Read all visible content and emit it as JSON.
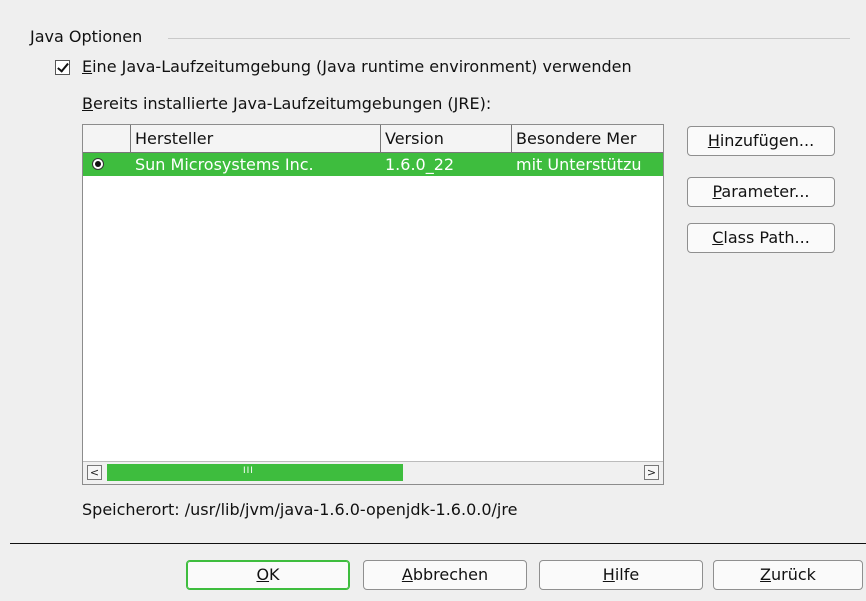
{
  "group": {
    "title": "Java Optionen",
    "checkbox_label_mnemonic": "E",
    "checkbox_label_rest": "ine Java-Laufzeitumgebung (Java runtime environment) verwenden",
    "checkbox_checked": true,
    "installed_label_mnemonic": "B",
    "installed_label_rest": "ereits installierte Java-Laufzeitumgebungen (JRE):"
  },
  "table": {
    "columns": [
      "",
      "Hersteller",
      "Version",
      "Besondere Mer"
    ],
    "rows": [
      {
        "selected": true,
        "vendor": "Sun Microsystems Inc.",
        "version": "1.6.0_22",
        "features": "mit Unterstützu"
      }
    ],
    "scroll_left": "<",
    "scroll_right": ">",
    "scroll_grip": "III"
  },
  "side_buttons": {
    "add": {
      "mnemonic": "H",
      "rest": "inzufügen..."
    },
    "params": {
      "mnemonic": "P",
      "rest": "arameter..."
    },
    "classpath": {
      "mnemonic": "C",
      "rest": "lass Path..."
    }
  },
  "location": "Speicherort: /usr/lib/jvm/java-1.6.0-openjdk-1.6.0.0/jre",
  "footer": {
    "ok": {
      "mnemonic": "O",
      "rest": "K"
    },
    "cancel": {
      "mnemonic": "A",
      "rest": "bbrechen"
    },
    "help": {
      "mnemonic": "H",
      "rest": "ilfe"
    },
    "back": {
      "mnemonic": "Z",
      "rest": "urück"
    }
  },
  "colors": {
    "selection": "#3ebd3e",
    "default_button_border": "#3ebd3e"
  }
}
